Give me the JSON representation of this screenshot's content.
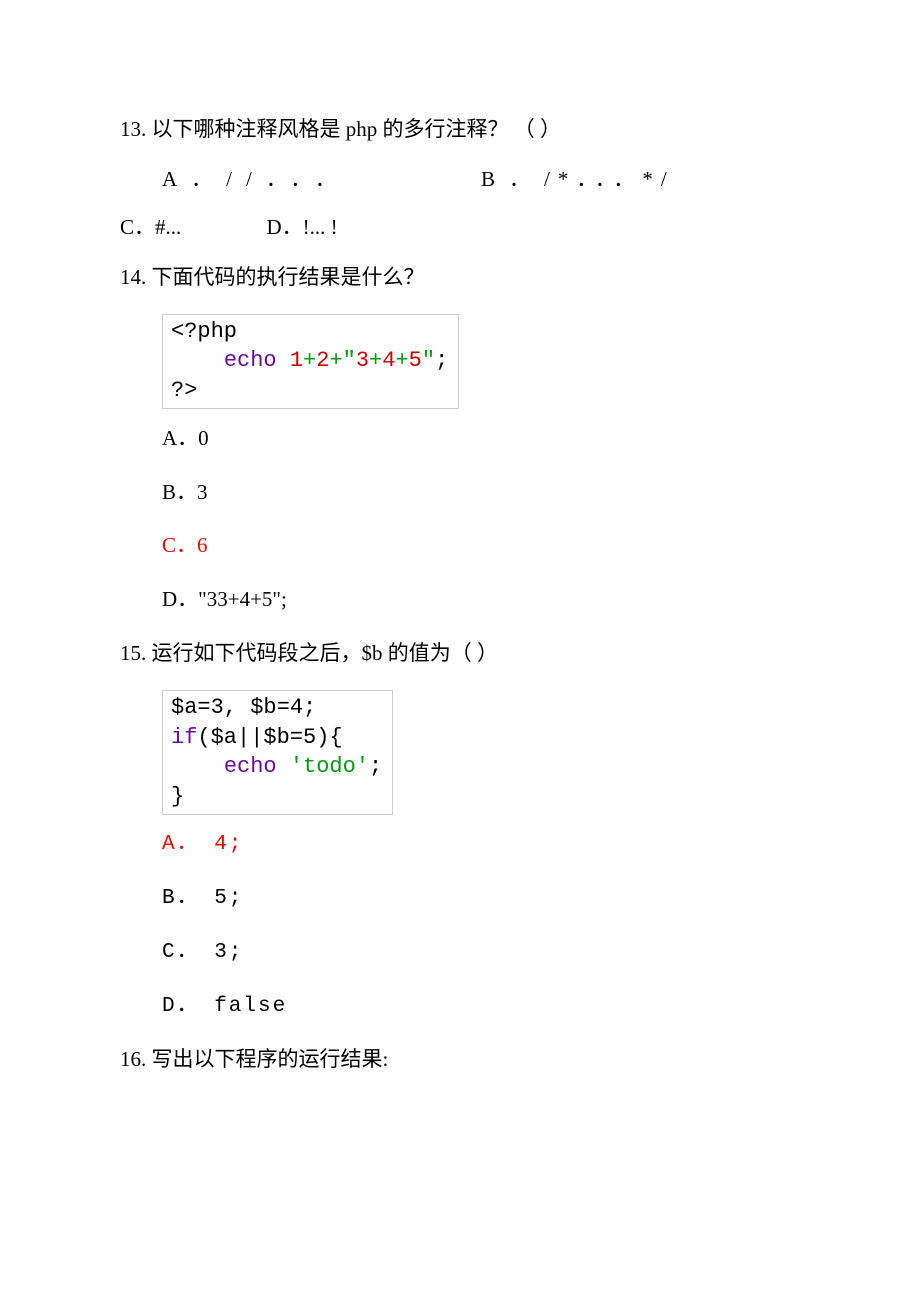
{
  "q13": {
    "num": "13.",
    "text": "以下哪种注释风格是 php 的多行注释？   （    ）",
    "optA_label": "A．",
    "optA_val": "//．．．",
    "optB_label": "B．",
    "optB_val": "/*．．．*/",
    "optC": "C．#...",
    "optD": "D．!... !"
  },
  "q14": {
    "num": "14.",
    "text": "下面代码的执行结果是什么？",
    "code": {
      "l1a": "<?php",
      "l2_echo": "echo",
      "l2_1": "1",
      "l2_p1": "+",
      "l2_2": "2",
      "l2_p2": "+",
      "l2_q1": "\"",
      "l2_3": "3",
      "l2_p3": "+",
      "l2_4": "4",
      "l2_p4": "+",
      "l2_5": "5",
      "l2_q2": "\"",
      "l2_semi": ";",
      "l3": "?>"
    },
    "optA": "A．0",
    "optB": "B．3",
    "optC": "C．6",
    "optD": "D．\"33+4+5\";"
  },
  "q15": {
    "num": "15.",
    "text": "运行如下代码段之后，$b 的值为（ ）",
    "code": {
      "l1": "$a=3, $b=4;",
      "l2_if": "if",
      "l2_rest": "($a||$b=5){",
      "l3_echo": "echo",
      "l3_sp": " ",
      "l3_str": "'todo'",
      "l3_semi": ";",
      "l4": "}"
    },
    "optA": "A． 4;",
    "optB": "B． 5;",
    "optC": "C． 3;",
    "optD": "D． false"
  },
  "q16": {
    "num": "16.",
    "text": "写出以下程序的运行结果:"
  }
}
